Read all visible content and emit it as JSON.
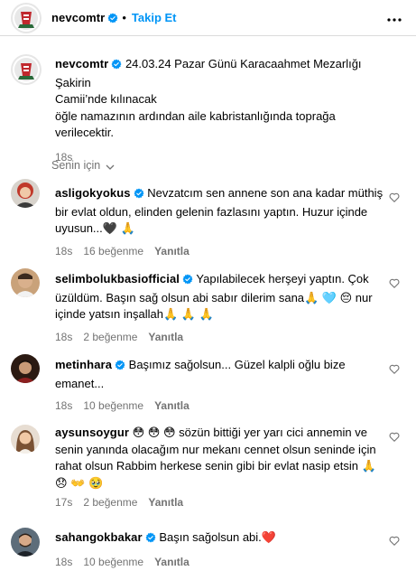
{
  "header": {
    "username": "nevcomtr",
    "follow_label": "Takip Et",
    "separator": "•"
  },
  "post": {
    "username": "nevcomtr",
    "caption_line1": "24.03.24 Pazar Günü Karacaahmet Mezarlığı Şakirin",
    "caption_line2": "Camii’nde kılınacak",
    "caption_line3": "öğle namazının ardından aile kabristanlığında toprağa",
    "caption_line4": "verilecektir.",
    "time": "18s"
  },
  "filter": {
    "label": "Senin için"
  },
  "comments": [
    {
      "username": "asligokyokus",
      "line1": "Nevzatcım sen annene son ana kadar müthiş",
      "line2": "bir evlat oldun, elinden gelenin fazlasını yaptın. Huzur içinde",
      "line3": "uyusun...🖤 🙏",
      "time": "18s",
      "likes": "16 beğenme",
      "reply": "Yanıtla"
    },
    {
      "username": "selimbolukbasiofficial",
      "line1": "Yapılabilecek herşeyi yaptın. Çok",
      "line2": "üzüldüm. Başın sağ olsun abi sabır dilerim sana🙏 🩵 😔 nur",
      "line3": "içinde yatsın inşallah🙏 🙏 🙏",
      "time": "18s",
      "likes": "2 beğenme",
      "reply": "Yanıtla"
    },
    {
      "username": "metinhara",
      "line1": "Başımız sağolsun... Güzel kalpli oğlu bize",
      "line2": "emanet...",
      "line3": "",
      "time": "18s",
      "likes": "10 beğenme",
      "reply": "Yanıtla"
    },
    {
      "username": "aysunsoygur",
      "line1": "😳 😳 😳 sözün bittiği yer yarı cici annemin ve",
      "line2": "senin yanında olacağım nur mekanı cennet olsun seninde için",
      "line3": "rahat olsun Rabbim herkese senin gibi bir evlat nasip etsin 🙏",
      "line4": "😞 👐 🥹",
      "time": "17s",
      "likes": "2 beğenme",
      "reply": "Yanıtla"
    },
    {
      "username": "sahangokbakar",
      "line1": "Başın sağolsun abi.❤️",
      "time": "18s",
      "likes": "10 beğenme",
      "reply": "Yanıtla"
    }
  ],
  "icons": {
    "verified": "verified-badge-icon",
    "more": "more-options-icon",
    "heart": "heart-outline-icon",
    "chevron": "chevron-down-icon"
  },
  "colors": {
    "follow_blue": "#0095f6",
    "verified_blue": "#0095f6",
    "meta_gray": "#737373"
  }
}
